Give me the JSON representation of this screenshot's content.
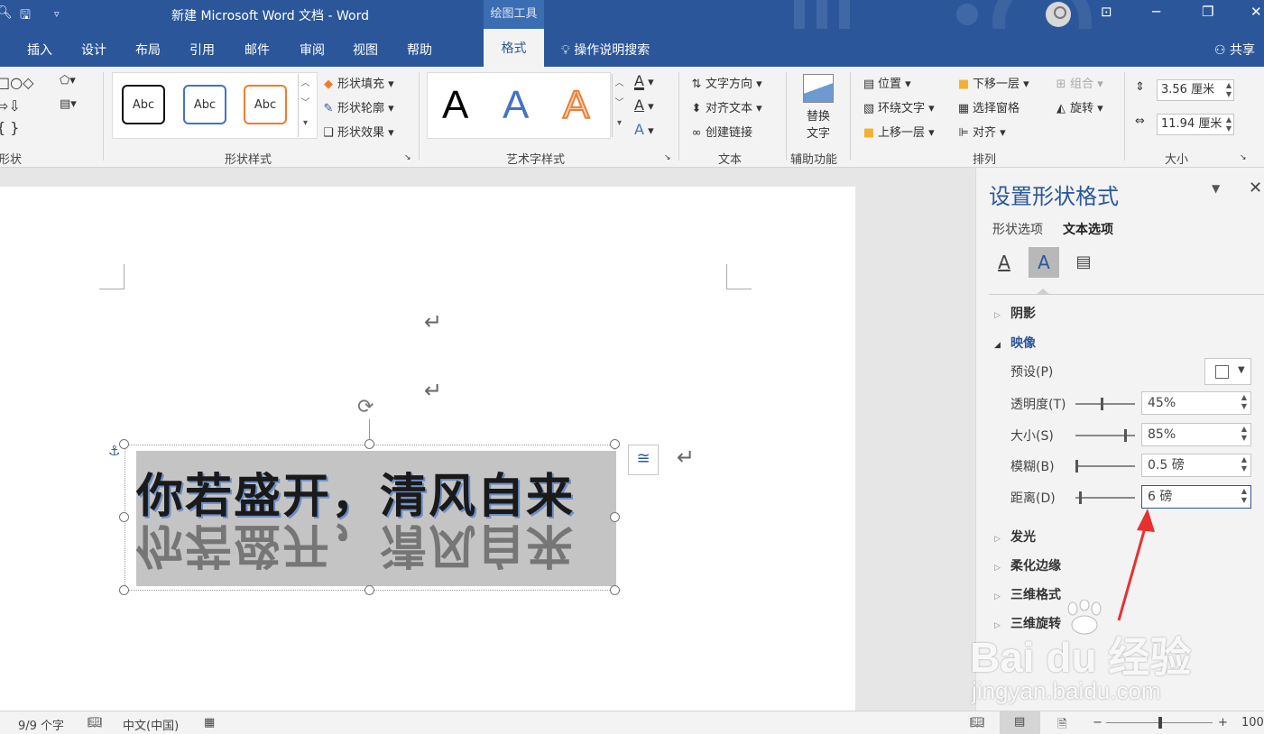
{
  "window": {
    "title": "新建 Microsoft Word 文档 - Word",
    "context_tab_group": "绘图工具"
  },
  "tabs": [
    "插入",
    "设计",
    "布局",
    "引用",
    "邮件",
    "审阅",
    "视图",
    "帮助"
  ],
  "active_tab": "格式",
  "tell_me": "操作说明搜索",
  "share": "共享",
  "ribbon": {
    "insert_shapes": {
      "label": "形状"
    },
    "shape_styles": {
      "label": "形状样式",
      "presets": [
        "Abc",
        "Abc",
        "Abc"
      ],
      "fill": "形状填充",
      "outline": "形状轮廓",
      "effects": "形状效果"
    },
    "wordart_styles": {
      "label": "艺术字样式",
      "presets": [
        "A",
        "A",
        "A"
      ]
    },
    "text": {
      "label": "文本",
      "direction": "文字方向",
      "align": "对齐文本",
      "link": "创建链接"
    },
    "accessibility": {
      "label": "辅助功能",
      "alt_text_line1": "替换",
      "alt_text_line2": "文字"
    },
    "arrange": {
      "label": "排列",
      "position": "位置",
      "wrap": "环绕文字",
      "bring_forward": "上移一层",
      "send_backward": "下移一层",
      "selection_pane": "选择窗格",
      "align": "对齐",
      "group": "组合",
      "rotate": "旋转"
    },
    "size": {
      "label": "大小",
      "height": "3.56 厘米",
      "width": "11.94 厘米"
    }
  },
  "document": {
    "shape_text": "你若盛开，清风自来",
    "paragraph_mark": "↵"
  },
  "pane": {
    "title": "设置形状格式",
    "tabs": [
      "形状选项",
      "文本选项"
    ],
    "sections": {
      "shadow": "阴影",
      "reflection": "映像",
      "glow": "发光",
      "soft_edges": "柔化边缘",
      "format_3d": "三维格式",
      "rotation_3d": "三维旋转"
    },
    "reflection": {
      "preset_label": "预设(P)",
      "transparency_label": "透明度(T)",
      "transparency": "45%",
      "size_label": "大小(S)",
      "size": "85%",
      "blur_label": "模糊(B)",
      "blur": "0.5 磅",
      "distance_label": "距离(D)",
      "distance": "6 磅"
    },
    "slider_levels": {
      "transparency": 0.45,
      "size": 0.85,
      "blur": 0.005,
      "distance": 0.06
    }
  },
  "status": {
    "word_count": "9/9 个字",
    "language": "中文(中国)",
    "zoom": "100"
  },
  "watermark": {
    "logo": "Bai du 经验",
    "url": "jingyan.baidu.com"
  },
  "colors": {
    "word_blue": "#2b579a",
    "annotation_red": "#e8312f"
  }
}
